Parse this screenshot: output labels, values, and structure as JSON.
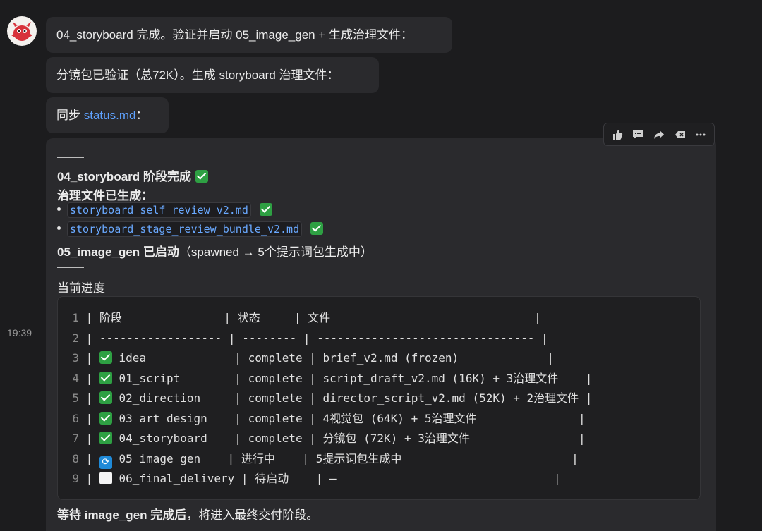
{
  "messages": [
    {
      "text": "04_storyboard 完成。验证并启动 05_image_gen + 生成治理文件："
    },
    {
      "text": "分镜包已验证（总72K）。生成 storyboard 治理文件："
    },
    {
      "prefix": "同步 ",
      "link": "status.md",
      "suffix": "："
    }
  ],
  "timestamp": "19:39",
  "toolbar": {
    "icons": [
      "thumbs-up-icon",
      "comment-icon",
      "share-icon",
      "backspace-icon",
      "more-icon"
    ]
  },
  "card": {
    "divider": "——",
    "heading": "04_storyboard 阶段完成",
    "files_title": "治理文件已生成：",
    "files": [
      "storyboard_self_review_v2.md",
      "storyboard_stage_review_bundle_v2.md"
    ],
    "image_gen_bold": "05_image_gen 已启动",
    "image_gen_rest": "（spawned → 5个提示词包生成中）",
    "progress_label": "当前进度",
    "table_rows": [
      {
        "n": "1",
        "status": "",
        "pre": " | 阶段               | 状态     | 文件                              |",
        "icon": ""
      },
      {
        "n": "2",
        "pre": " | ------------------ | -------- | -------------------------------- |",
        "icon": ""
      },
      {
        "n": "3",
        "pre": " | ",
        "icon": "done",
        "post": " idea             | complete | brief_v2.md (frozen)             |"
      },
      {
        "n": "4",
        "pre": " | ",
        "icon": "done",
        "post": " 01_script        | complete | script_draft_v2.md (16K) + 3治理文件    |"
      },
      {
        "n": "5",
        "pre": " | ",
        "icon": "done",
        "post": " 02_direction     | complete | director_script_v2.md (52K) + 2治理文件 |"
      },
      {
        "n": "6",
        "pre": " | ",
        "icon": "done",
        "post": " 03_art_design    | complete | 4视觉包 (64K) + 5治理文件               |"
      },
      {
        "n": "7",
        "pre": " | ",
        "icon": "done",
        "post": " 04_storyboard    | complete | 分镜包 (72K) + 3治理文件                |"
      },
      {
        "n": "8",
        "pre": " | ",
        "icon": "prog",
        "post": " 05_image_gen    | 进行中    | 5提示词包生成中                         |"
      },
      {
        "n": "9",
        "pre": " | ",
        "icon": "todo",
        "post": " 06_final_delivery | 待启动    | —                                |"
      }
    ],
    "footer_bold": "等待 image_gen 完成后",
    "footer_rest": "，将进入最终交付阶段。"
  }
}
